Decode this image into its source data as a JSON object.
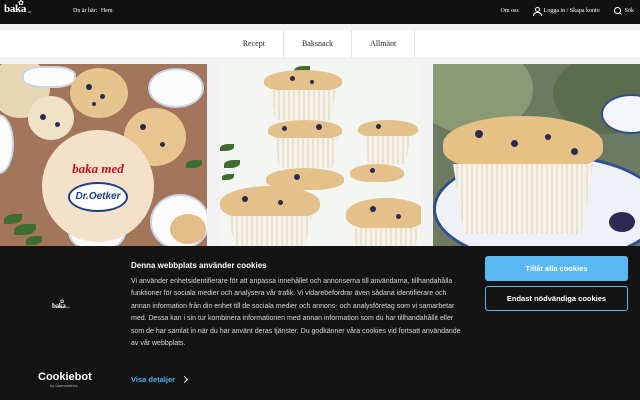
{
  "header": {
    "logo": {
      "word": "baka",
      "tag": ".se"
    },
    "breadcrumb": {
      "prefix": "Du är här:",
      "home": "Hem"
    },
    "about": "Om oss",
    "login": "Logga in / Skapa konto",
    "search": "Sök"
  },
  "categories": [
    "Recept",
    "Baksnack",
    "Allmänt"
  ],
  "hero": {
    "badge_text": "baka med",
    "badge_brand": "Dr.Oetker"
  },
  "cookie": {
    "title": "Denna webbplats använder cookies",
    "body": "Vi använder enhetsidentifierare för att anpassa innehållet och annonserna till användarna, tillhandahålla funktioner för sociala medier och analysera vår trafik. Vi vidarebefordrar även sådana identifierare och annan information från din enhet till de sociala medier och annons- och analysföretag som vi samarbetar med. Dessa kan i sin tur kombinera informationen med annan information som du har tillhandahållit eller som de har samlat in när du har använt deras tjänster. Du godkänner våra cookies vid fortsatt användande av vår webbplats.",
    "details_link": "Visa detaljer",
    "allow_all": "Tillåt alla cookies",
    "necessary_only": "Endast nödvändiga cookies",
    "powered_by": {
      "brand": "Cookiebot",
      "sub": "by Usercentrics"
    },
    "logo": {
      "word": "baka",
      "tag": ".se"
    }
  },
  "colors": {
    "topbar": "#111111",
    "banner": "#141414",
    "accent": "#5ab8f2",
    "badge_red": "#c1121f",
    "oetker_blue": "#1b3f8b"
  }
}
